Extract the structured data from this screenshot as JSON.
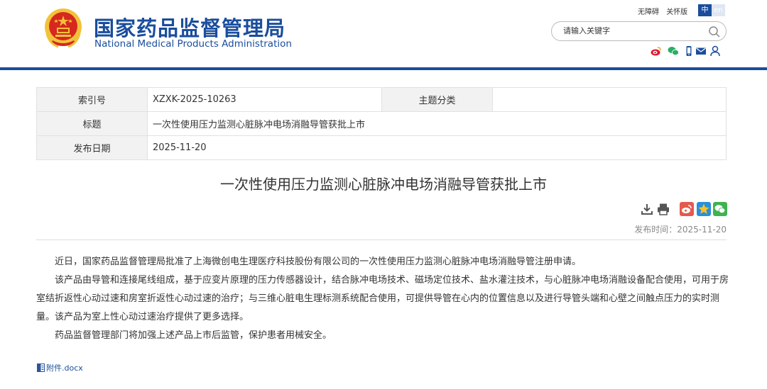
{
  "header": {
    "title": "国家药品监督管理局",
    "subtitle": "National Medical Products Administration",
    "links": [
      "无障碍",
      "关怀版"
    ],
    "lang_zh": "中",
    "lang_en": "en",
    "search_placeholder": "请输入关键字"
  },
  "social_icons": [
    "weibo-icon",
    "wechat-icon",
    "mobile-icon",
    "mail-icon",
    "user-icon"
  ],
  "info": {
    "index_label": "索引号",
    "index_value": "XZXK-2025-10263",
    "topic_label": "主题分类",
    "topic_value": "",
    "title_label": "标题",
    "title_value": "一次性使用压力监测心脏脉冲电场消融导管获批上市",
    "date_label": "发布日期",
    "date_value": "2025-11-20"
  },
  "article": {
    "title": "一次性使用压力监测心脏脉冲电场消融导管获批上市",
    "publish_time": "发布时间：2025-11-20",
    "paragraphs": [
      "近日，国家药品监督管理局批准了上海微创电生理医疗科技股份有限公司的一次性使用压力监测心脏脉冲电场消融导管注册申请。",
      "该产品由导管和连接尾线组成，基于应变片原理的压力传感器设计，结合脉冲电场技术、磁场定位技术、盐水灌注技术，与心脏脉冲电场消融设备配合使用，可用于房室结折返性心动过速和房室折返性心动过速的治疗；与三维心脏电生理标测系统配合使用，可提供导管在心内的位置信息以及进行导管头端和心壁之间触点压力的实时测量。该产品为室上性心动过速治疗提供了更多选择。",
      "药品监督管理部门将加强上述产品上市后监管，保护患者用械安全。"
    ],
    "attachment": "附件.docx"
  },
  "colors": {
    "brand_blue": "#1a4d9c",
    "emblem_red": "#d6281e",
    "emblem_gold": "#f2c23a"
  }
}
